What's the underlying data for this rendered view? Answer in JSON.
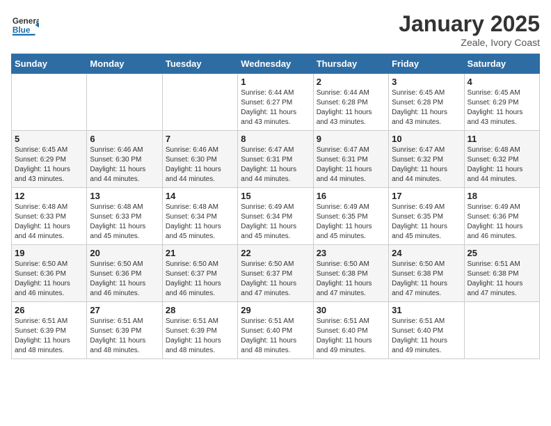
{
  "header": {
    "logo_general": "General",
    "logo_blue": "Blue",
    "month": "January 2025",
    "location": "Zeale, Ivory Coast"
  },
  "weekdays": [
    "Sunday",
    "Monday",
    "Tuesday",
    "Wednesday",
    "Thursday",
    "Friday",
    "Saturday"
  ],
  "weeks": [
    [
      {
        "day": "",
        "info": ""
      },
      {
        "day": "",
        "info": ""
      },
      {
        "day": "",
        "info": ""
      },
      {
        "day": "1",
        "info": "Sunrise: 6:44 AM\nSunset: 6:27 PM\nDaylight: 11 hours\nand 43 minutes."
      },
      {
        "day": "2",
        "info": "Sunrise: 6:44 AM\nSunset: 6:28 PM\nDaylight: 11 hours\nand 43 minutes."
      },
      {
        "day": "3",
        "info": "Sunrise: 6:45 AM\nSunset: 6:28 PM\nDaylight: 11 hours\nand 43 minutes."
      },
      {
        "day": "4",
        "info": "Sunrise: 6:45 AM\nSunset: 6:29 PM\nDaylight: 11 hours\nand 43 minutes."
      }
    ],
    [
      {
        "day": "5",
        "info": "Sunrise: 6:45 AM\nSunset: 6:29 PM\nDaylight: 11 hours\nand 43 minutes."
      },
      {
        "day": "6",
        "info": "Sunrise: 6:46 AM\nSunset: 6:30 PM\nDaylight: 11 hours\nand 44 minutes."
      },
      {
        "day": "7",
        "info": "Sunrise: 6:46 AM\nSunset: 6:30 PM\nDaylight: 11 hours\nand 44 minutes."
      },
      {
        "day": "8",
        "info": "Sunrise: 6:47 AM\nSunset: 6:31 PM\nDaylight: 11 hours\nand 44 minutes."
      },
      {
        "day": "9",
        "info": "Sunrise: 6:47 AM\nSunset: 6:31 PM\nDaylight: 11 hours\nand 44 minutes."
      },
      {
        "day": "10",
        "info": "Sunrise: 6:47 AM\nSunset: 6:32 PM\nDaylight: 11 hours\nand 44 minutes."
      },
      {
        "day": "11",
        "info": "Sunrise: 6:48 AM\nSunset: 6:32 PM\nDaylight: 11 hours\nand 44 minutes."
      }
    ],
    [
      {
        "day": "12",
        "info": "Sunrise: 6:48 AM\nSunset: 6:33 PM\nDaylight: 11 hours\nand 44 minutes."
      },
      {
        "day": "13",
        "info": "Sunrise: 6:48 AM\nSunset: 6:33 PM\nDaylight: 11 hours\nand 45 minutes."
      },
      {
        "day": "14",
        "info": "Sunrise: 6:48 AM\nSunset: 6:34 PM\nDaylight: 11 hours\nand 45 minutes."
      },
      {
        "day": "15",
        "info": "Sunrise: 6:49 AM\nSunset: 6:34 PM\nDaylight: 11 hours\nand 45 minutes."
      },
      {
        "day": "16",
        "info": "Sunrise: 6:49 AM\nSunset: 6:35 PM\nDaylight: 11 hours\nand 45 minutes."
      },
      {
        "day": "17",
        "info": "Sunrise: 6:49 AM\nSunset: 6:35 PM\nDaylight: 11 hours\nand 45 minutes."
      },
      {
        "day": "18",
        "info": "Sunrise: 6:49 AM\nSunset: 6:36 PM\nDaylight: 11 hours\nand 46 minutes."
      }
    ],
    [
      {
        "day": "19",
        "info": "Sunrise: 6:50 AM\nSunset: 6:36 PM\nDaylight: 11 hours\nand 46 minutes."
      },
      {
        "day": "20",
        "info": "Sunrise: 6:50 AM\nSunset: 6:36 PM\nDaylight: 11 hours\nand 46 minutes."
      },
      {
        "day": "21",
        "info": "Sunrise: 6:50 AM\nSunset: 6:37 PM\nDaylight: 11 hours\nand 46 minutes."
      },
      {
        "day": "22",
        "info": "Sunrise: 6:50 AM\nSunset: 6:37 PM\nDaylight: 11 hours\nand 47 minutes."
      },
      {
        "day": "23",
        "info": "Sunrise: 6:50 AM\nSunset: 6:38 PM\nDaylight: 11 hours\nand 47 minutes."
      },
      {
        "day": "24",
        "info": "Sunrise: 6:50 AM\nSunset: 6:38 PM\nDaylight: 11 hours\nand 47 minutes."
      },
      {
        "day": "25",
        "info": "Sunrise: 6:51 AM\nSunset: 6:38 PM\nDaylight: 11 hours\nand 47 minutes."
      }
    ],
    [
      {
        "day": "26",
        "info": "Sunrise: 6:51 AM\nSunset: 6:39 PM\nDaylight: 11 hours\nand 48 minutes."
      },
      {
        "day": "27",
        "info": "Sunrise: 6:51 AM\nSunset: 6:39 PM\nDaylight: 11 hours\nand 48 minutes."
      },
      {
        "day": "28",
        "info": "Sunrise: 6:51 AM\nSunset: 6:39 PM\nDaylight: 11 hours\nand 48 minutes."
      },
      {
        "day": "29",
        "info": "Sunrise: 6:51 AM\nSunset: 6:40 PM\nDaylight: 11 hours\nand 48 minutes."
      },
      {
        "day": "30",
        "info": "Sunrise: 6:51 AM\nSunset: 6:40 PM\nDaylight: 11 hours\nand 49 minutes."
      },
      {
        "day": "31",
        "info": "Sunrise: 6:51 AM\nSunset: 6:40 PM\nDaylight: 11 hours\nand 49 minutes."
      },
      {
        "day": "",
        "info": ""
      }
    ]
  ]
}
